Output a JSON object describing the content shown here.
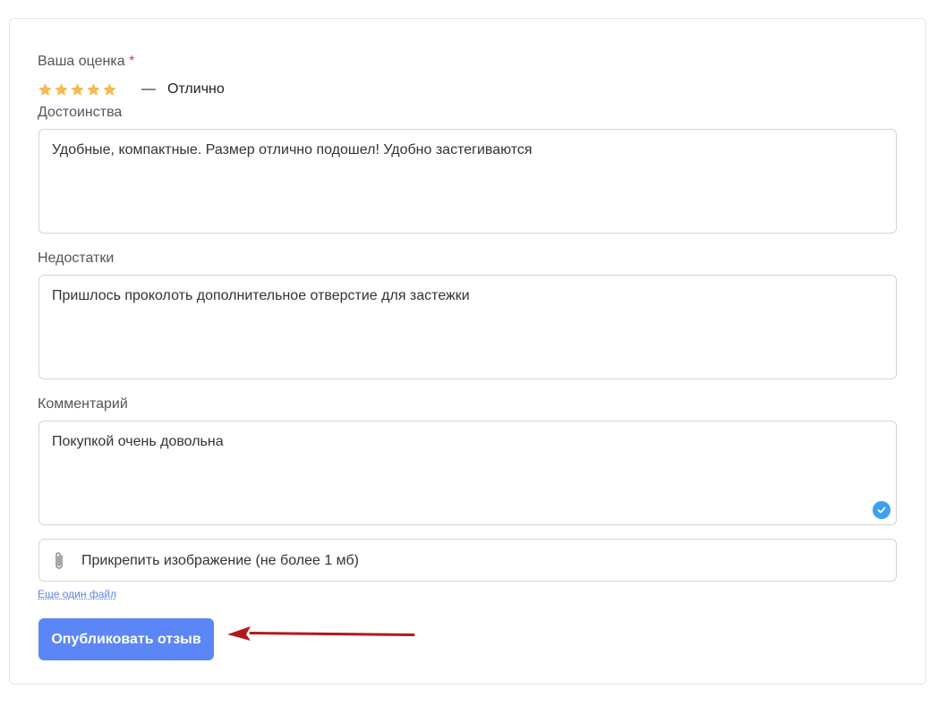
{
  "form": {
    "rating_label": "Ваша оценка",
    "required_mark": "*",
    "rating": {
      "value": 5,
      "max": 5,
      "star_color": "#f7b955"
    },
    "rating_dash": "—",
    "rating_text": "Отлично",
    "pros_label": "Достоинства",
    "pros_value": "Удобные, компактные. Размер отлично подошел! Удобно застегиваются",
    "cons_label": "Недостатки",
    "cons_value": "Пришлось проколоть дополнительное отверстие для застежки",
    "comment_label": "Комментарий",
    "comment_value": "Покупкой очень довольна",
    "attach_label": "Прикрепить изображение (не более 1 мб)",
    "more_file_link": "Еще один файл",
    "publish_button": "Опубликовать отзыв"
  },
  "colors": {
    "button": "#5b86f5",
    "arrow": "#b3191a",
    "check": "#3ea0f0"
  }
}
